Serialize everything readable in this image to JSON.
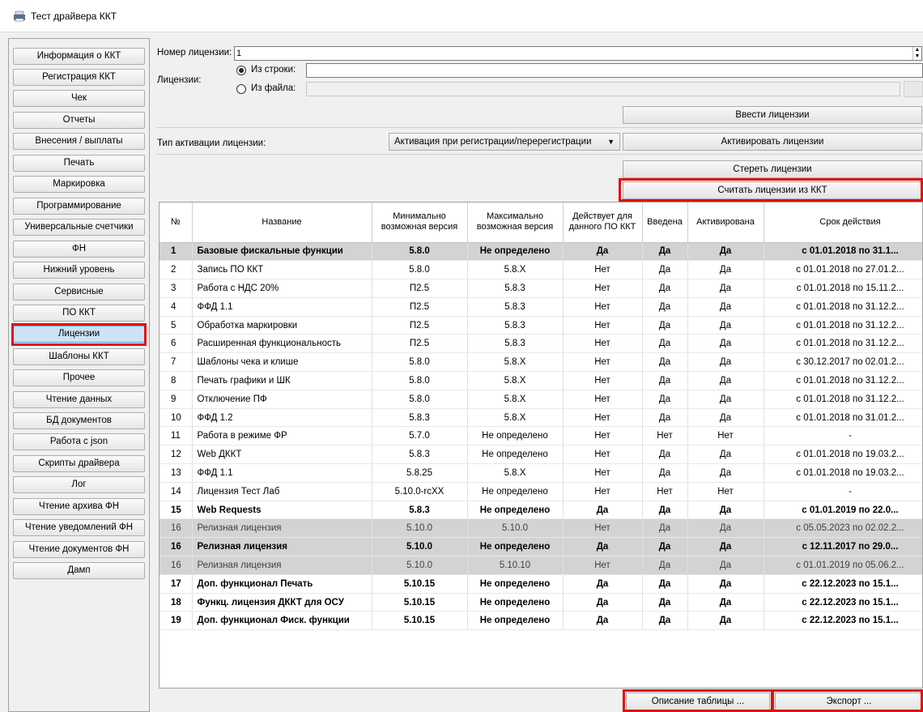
{
  "window": {
    "title": "Тест драйвера ККТ"
  },
  "sidebar": {
    "items": [
      "Информация о ККТ",
      "Регистрация ККТ",
      "Чек",
      "Отчеты",
      "Внесения / выплаты",
      "Печать",
      "Маркировка",
      "Программирование",
      "Универсальные счетчики",
      "ФН",
      "Нижний уровень",
      "Сервисные",
      "ПО ККТ",
      "Лицензии",
      "Шаблоны ККТ",
      "Прочее",
      "Чтение данных",
      "БД документов",
      "Работа с json",
      "Скрипты драйвера",
      "Лог",
      "Чтение архива ФН",
      "Чтение уведомлений ФН",
      "Чтение документов ФН",
      "Дамп"
    ],
    "active": "Лицензии"
  },
  "form": {
    "license_number_label": "Номер лицензии:",
    "license_number_value": "1",
    "licenses_label": "Лицензии:",
    "from_string_label": "Из строки:",
    "from_file_label": "Из файла:",
    "enter_button": "Ввести лицензии",
    "activation_type_label": "Тип активации лицензии:",
    "activation_type_value": "Активация при регистрации/перерегистрации",
    "activate_button": "Активировать лицензии",
    "erase_button": "Стереть лицензии",
    "read_button": "Считать лицензии из ККТ"
  },
  "table": {
    "columns": [
      "№",
      "Название",
      "Минимально возможная версия",
      "Максимально возможная версия",
      "Действует для данного ПО ККТ",
      "Введена",
      "Активирована",
      "Срок действия"
    ],
    "rows": [
      {
        "no": "1",
        "name": "Базовые фискальные функции",
        "min": "5.8.0",
        "max": "Не определено",
        "valid": "Да",
        "entered": "Да",
        "activated": "Да",
        "term": "с 01.01.2018 по 31.1...",
        "style": "bold gray"
      },
      {
        "no": "2",
        "name": "Запись ПО ККТ",
        "min": "5.8.0",
        "max": "5.8.X",
        "valid": "Нет",
        "entered": "Да",
        "activated": "Да",
        "term": "с 01.01.2018 по 27.01.2...",
        "style": ""
      },
      {
        "no": "3",
        "name": "Работа с НДС 20%",
        "min": "П2.5",
        "max": "5.8.3",
        "valid": "Нет",
        "entered": "Да",
        "activated": "Да",
        "term": "с 01.01.2018 по 15.11.2...",
        "style": ""
      },
      {
        "no": "4",
        "name": "ФФД 1.1",
        "min": "П2.5",
        "max": "5.8.3",
        "valid": "Нет",
        "entered": "Да",
        "activated": "Да",
        "term": "с 01.01.2018 по 31.12.2...",
        "style": ""
      },
      {
        "no": "5",
        "name": "Обработка маркировки",
        "min": "П2.5",
        "max": "5.8.3",
        "valid": "Нет",
        "entered": "Да",
        "activated": "Да",
        "term": "с 01.01.2018 по 31.12.2...",
        "style": ""
      },
      {
        "no": "6",
        "name": "Расширенная функциональность",
        "min": "П2.5",
        "max": "5.8.3",
        "valid": "Нет",
        "entered": "Да",
        "activated": "Да",
        "term": "с 01.01.2018 по 31.12.2...",
        "style": ""
      },
      {
        "no": "7",
        "name": "Шаблоны чека и клише",
        "min": "5.8.0",
        "max": "5.8.X",
        "valid": "Нет",
        "entered": "Да",
        "activated": "Да",
        "term": "с 30.12.2017 по 02.01.2...",
        "style": ""
      },
      {
        "no": "8",
        "name": "Печать графики и ШК",
        "min": "5.8.0",
        "max": "5.8.X",
        "valid": "Нет",
        "entered": "Да",
        "activated": "Да",
        "term": "с 01.01.2018 по 31.12.2...",
        "style": ""
      },
      {
        "no": "9",
        "name": "Отключение ПФ",
        "min": "5.8.0",
        "max": "5.8.X",
        "valid": "Нет",
        "entered": "Да",
        "activated": "Да",
        "term": "с 01.01.2018 по 31.12.2...",
        "style": ""
      },
      {
        "no": "10",
        "name": "ФФД 1.2",
        "min": "5.8.3",
        "max": "5.8.X",
        "valid": "Нет",
        "entered": "Да",
        "activated": "Да",
        "term": "с 01.01.2018 по 31.01.2...",
        "style": ""
      },
      {
        "no": "11",
        "name": "Работа в режиме ФР",
        "min": "5.7.0",
        "max": "Не определено",
        "valid": "Нет",
        "entered": "Нет",
        "activated": "Нет",
        "term": "-",
        "style": ""
      },
      {
        "no": "12",
        "name": "Web ДККТ",
        "min": "5.8.3",
        "max": "Не определено",
        "valid": "Нет",
        "entered": "Да",
        "activated": "Да",
        "term": "с 01.01.2018 по 19.03.2...",
        "style": ""
      },
      {
        "no": "13",
        "name": "ФФД 1.1",
        "min": "5.8.25",
        "max": "5.8.X",
        "valid": "Нет",
        "entered": "Да",
        "activated": "Да",
        "term": "с 01.01.2018 по 19.03.2...",
        "style": ""
      },
      {
        "no": "14",
        "name": "Лицензия Тест Лаб",
        "min": "5.10.0-rcXX",
        "max": "Не определено",
        "valid": "Нет",
        "entered": "Нет",
        "activated": "Нет",
        "term": "-",
        "style": ""
      },
      {
        "no": "15",
        "name": "Web Requests",
        "min": "5.8.3",
        "max": "Не определено",
        "valid": "Да",
        "entered": "Да",
        "activated": "Да",
        "term": "с 01.01.2019 по 22.0...",
        "style": "bold"
      },
      {
        "no": "16",
        "name": "Релизная лицензия",
        "min": "5.10.0",
        "max": "5.10.0",
        "valid": "Нет",
        "entered": "Да",
        "activated": "Да",
        "term": "с 05.05.2023 по 02.02.2...",
        "style": "gray dim"
      },
      {
        "no": "16",
        "name": "Релизная лицензия",
        "min": "5.10.0",
        "max": "Не определено",
        "valid": "Да",
        "entered": "Да",
        "activated": "Да",
        "term": "с 12.11.2017 по 29.0...",
        "style": "bold gray"
      },
      {
        "no": "16",
        "name": "Релизная лицензия",
        "min": "5.10.0",
        "max": "5.10.10",
        "valid": "Нет",
        "entered": "Да",
        "activated": "Да",
        "term": "с 01.01.2019 по 05.06.2...",
        "style": "gray dim"
      },
      {
        "no": "17",
        "name": "Доп. функционал Печать",
        "min": "5.10.15",
        "max": "Не определено",
        "valid": "Да",
        "entered": "Да",
        "activated": "Да",
        "term": "с 22.12.2023 по 15.1...",
        "style": "bold"
      },
      {
        "no": "18",
        "name": "Функц. лицензия ДККТ для ОСУ",
        "min": "5.10.15",
        "max": "Не определено",
        "valid": "Да",
        "entered": "Да",
        "activated": "Да",
        "term": "с 22.12.2023 по 15.1...",
        "style": "bold"
      },
      {
        "no": "19",
        "name": "Доп. функционал Фиск. функции",
        "min": "5.10.15",
        "max": "Не определено",
        "valid": "Да",
        "entered": "Да",
        "activated": "Да",
        "term": "с 22.12.2023 по 15.1...",
        "style": "bold"
      }
    ]
  },
  "footer": {
    "describe_button": "Описание таблицы ...",
    "export_button": "Экспорт ..."
  },
  "colors": {
    "highlight": "#e01010",
    "active_tab": "#cde4f7",
    "gray_row": "#d3d3d3"
  }
}
